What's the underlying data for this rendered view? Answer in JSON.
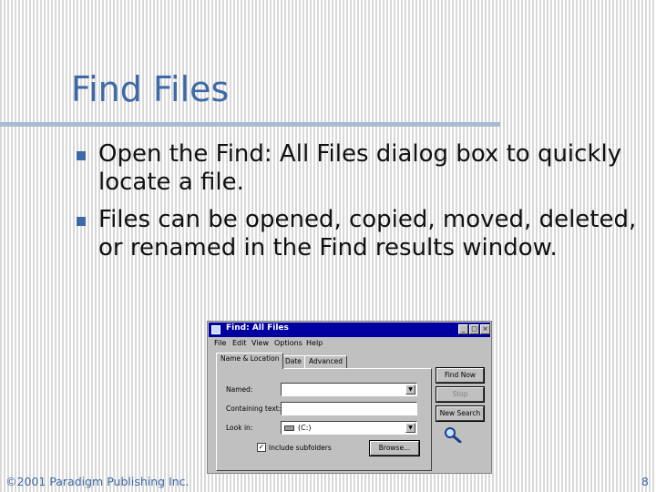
{
  "slide": {
    "title": "Find Files",
    "bullets": [
      "Open the Find: All Files dialog box to quickly locate a file.",
      "Files can be opened, copied, moved, deleted, or renamed in the Find results window."
    ],
    "accent_color": "#3d6aa6"
  },
  "find_dialog": {
    "title": "Find: All Files",
    "window_buttons": [
      "_",
      "□",
      "×"
    ],
    "menu": [
      "File",
      "Edit",
      "View",
      "Options",
      "Help"
    ],
    "tabs": [
      "Name & Location",
      "Date",
      "Advanced"
    ],
    "active_tab": "Name & Location",
    "fields": {
      "named_label": "Named:",
      "named_value": "",
      "containing_label": "Containing text:",
      "containing_value": "",
      "lookin_label": "Look in:",
      "lookin_value": "(C:)"
    },
    "subfolders_label": "Include subfolders",
    "subfolders_checked": true,
    "buttons": {
      "find_now": "Find Now",
      "stop": "Stop",
      "new_search": "New Search",
      "browse": "Browse..."
    }
  },
  "footer": {
    "copyright": "©2001 Paradigm Publishing Inc.",
    "page_number": "8"
  }
}
